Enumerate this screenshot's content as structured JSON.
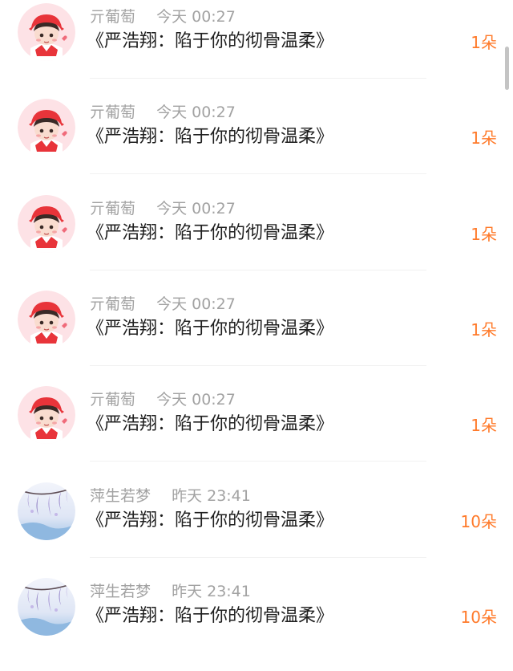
{
  "comments": [
    {
      "user": "亓葡萄",
      "time": "今天 00:27",
      "title": "《严浩翔：陷于你的彻骨温柔》",
      "count": "1朵",
      "avatar": "red-cap-boy-avatar"
    },
    {
      "user": "亓葡萄",
      "time": "今天 00:27",
      "title": "《严浩翔：陷于你的彻骨温柔》",
      "count": "1朵",
      "avatar": "red-cap-boy-avatar"
    },
    {
      "user": "亓葡萄",
      "time": "今天 00:27",
      "title": "《严浩翔：陷于你的彻骨温柔》",
      "count": "1朵",
      "avatar": "red-cap-boy-avatar"
    },
    {
      "user": "亓葡萄",
      "time": "今天 00:27",
      "title": "《严浩翔：陷于你的彻骨温柔》",
      "count": "1朵",
      "avatar": "red-cap-boy-avatar"
    },
    {
      "user": "亓葡萄",
      "time": "今天 00:27",
      "title": "《严浩翔：陷于你的彻骨温柔》",
      "count": "1朵",
      "avatar": "red-cap-boy-avatar"
    },
    {
      "user": "萍生若梦",
      "time": "昨天 23:41",
      "title": "《严浩翔：陷于你的彻骨温柔》",
      "count": "10朵",
      "avatar": "wisteria-avatar"
    },
    {
      "user": "萍生若梦",
      "time": "昨天 23:41",
      "title": "《严浩翔：陷于你的彻骨温柔》",
      "count": "10朵",
      "avatar": "wisteria-avatar"
    }
  ],
  "colors": {
    "meta_text": "#a2a2a2",
    "title_text": "#1f1f1f",
    "count_text": "#ff7a2a",
    "divider": "#f1f1f1"
  }
}
